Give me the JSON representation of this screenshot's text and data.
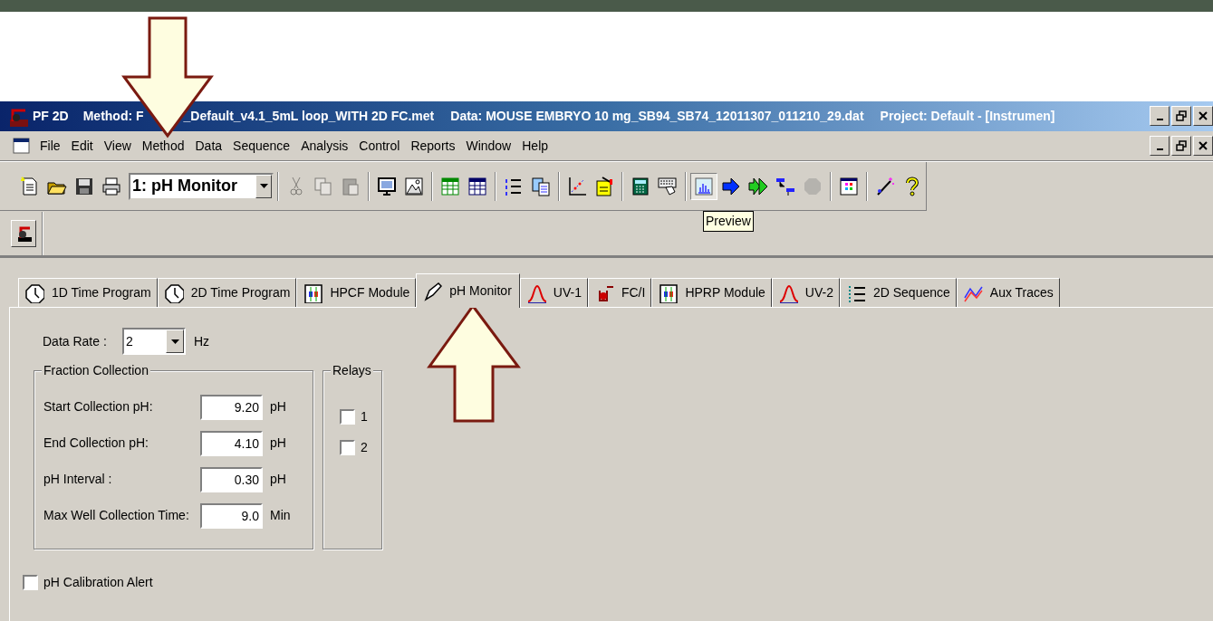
{
  "title_bar": {
    "app": "PF 2D",
    "method_start": "Method: F",
    "method_end": "_Default_v4.1_5mL loop_WITH 2D FC.met",
    "data": "Data: MOUSE EMBRYO 10 mg_SB94_SB74_12011307_011210_29.dat",
    "project": "Project: Default - [Instrumen]"
  },
  "menu": [
    "File",
    "Edit",
    "View",
    "Method",
    "Data",
    "Sequence",
    "Analysis",
    "Control",
    "Reports",
    "Window",
    "Help"
  ],
  "toolbar": {
    "combo": "1: pH Monitor",
    "groups": [
      [
        {
          "pressed": false,
          "disabled": false
        },
        {
          "pressed": false,
          "disabled": false
        },
        {
          "pressed": false,
          "disabled": false
        },
        {
          "pressed": false,
          "disabled": false
        }
      ],
      [
        {
          "pressed": false,
          "disabled": true
        },
        {
          "pressed": false,
          "disabled": true
        },
        {
          "pressed": false,
          "disabled": true
        }
      ],
      [
        {
          "pressed": false,
          "disabled": false
        },
        {
          "pressed": false,
          "disabled": false
        }
      ],
      [
        {
          "pressed": false,
          "disabled": false
        },
        {
          "pressed": false,
          "disabled": false
        }
      ],
      [
        {
          "pressed": false,
          "disabled": false
        },
        {
          "pressed": false,
          "disabled": false
        }
      ],
      [
        {
          "pressed": false,
          "disabled": false
        },
        {
          "pressed": false,
          "disabled": false
        }
      ],
      [
        {
          "pressed": false,
          "disabled": false
        },
        {
          "pressed": false,
          "disabled": false
        }
      ],
      [
        {
          "pressed": true,
          "disabled": false
        },
        {
          "pressed": false,
          "disabled": false
        },
        {
          "pressed": false,
          "disabled": false
        },
        {
          "pressed": false,
          "disabled": false
        },
        {
          "pressed": false,
          "disabled": true
        }
      ],
      [
        {
          "pressed": false,
          "disabled": false
        }
      ],
      [
        {
          "pressed": false,
          "disabled": false
        },
        {
          "pressed": false,
          "disabled": false
        }
      ]
    ],
    "tooltip": "Preview"
  },
  "tabs": [
    {
      "label": "1D Time Program",
      "selected": false
    },
    {
      "label": "2D Time Program",
      "selected": false
    },
    {
      "label": "HPCF Module",
      "selected": false
    },
    {
      "label": "pH Monitor",
      "selected": true
    },
    {
      "label": "UV-1",
      "selected": false
    },
    {
      "label": "FC/I",
      "selected": false
    },
    {
      "label": "HPRP Module",
      "selected": false
    },
    {
      "label": "UV-2",
      "selected": false
    },
    {
      "label": "2D Sequence",
      "selected": false
    },
    {
      "label": "Aux Traces",
      "selected": false
    }
  ],
  "data_rate": {
    "label": "Data Rate :",
    "value": "2",
    "unit": "Hz"
  },
  "fraction_collection": {
    "title": "Fraction Collection",
    "fields": [
      {
        "label": "Start Collection pH:",
        "value": "9.20",
        "unit": "pH"
      },
      {
        "label": "End Collection pH:",
        "value": "4.10",
        "unit": "pH"
      },
      {
        "label": "pH Interval :",
        "value": "0.30",
        "unit": "pH"
      },
      {
        "label": "Max Well Collection Time:",
        "value": "9.0",
        "unit": "Min"
      }
    ]
  },
  "relays": {
    "title": "Relays",
    "items": [
      {
        "label": "1",
        "checked": false
      },
      {
        "label": "2",
        "checked": false
      }
    ]
  },
  "calibration_alert": {
    "label": "pH Calibration Alert",
    "checked": false
  }
}
